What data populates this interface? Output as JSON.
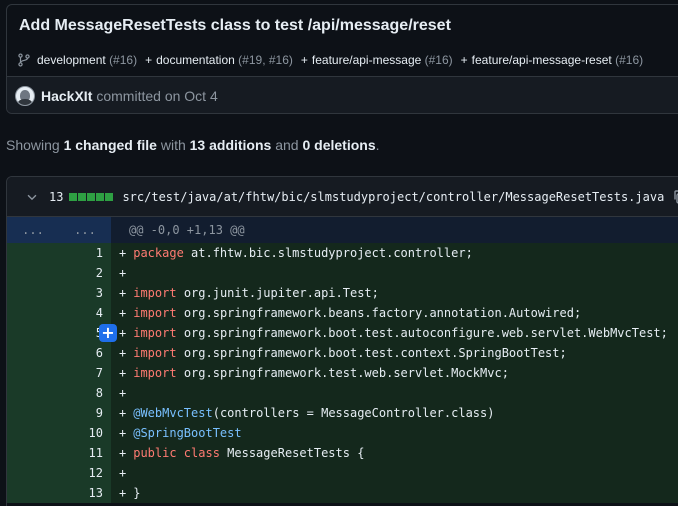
{
  "commit": {
    "title": "Add MessageResetTests class to test /api/message/reset",
    "branches": [
      {
        "name": "development",
        "count": "(#16)"
      },
      {
        "name": "documentation",
        "count": "(#19, #16)"
      },
      {
        "name": "feature/api-message",
        "count": "(#16)"
      },
      {
        "name": "feature/api-message-reset",
        "count": "(#16)"
      }
    ],
    "author": "HackXIt",
    "committed_text": "committed on Oct 4"
  },
  "summary": {
    "showing": "Showing",
    "files_changed": "1 changed file",
    "with": "with",
    "additions": "13 additions",
    "and": "and",
    "deletions": "0 deletions",
    "period": "."
  },
  "file": {
    "additions_count": "13",
    "path": "src/test/java/at/fhtw/bic/slmstudyproject/controller/MessageResetTests.java"
  },
  "hunk": {
    "expand_left": "...",
    "expand_right": "...",
    "header": "@@ -0,0 +1,13 @@"
  },
  "lines": [
    {
      "n": "1",
      "kw": "package",
      "text": " at.fhtw.bic.slmstudyproject.controller;"
    },
    {
      "n": "2",
      "kw": "",
      "text": ""
    },
    {
      "n": "3",
      "kw": "import",
      "text": " org.junit.jupiter.api.Test;"
    },
    {
      "n": "4",
      "kw": "import",
      "text": " org.springframework.beans.factory.annotation.Autowired;"
    },
    {
      "n": "5",
      "kw": "import",
      "text": " org.springframework.boot.test.autoconfigure.web.servlet.WebMvcTest;"
    },
    {
      "n": "6",
      "kw": "import",
      "text": " org.springframework.boot.test.context.SpringBootTest;"
    },
    {
      "n": "7",
      "kw": "import",
      "text": " org.springframework.test.web.servlet.MockMvc;"
    },
    {
      "n": "8",
      "kw": "",
      "text": ""
    },
    {
      "n": "9",
      "ann": "@WebMvcTest",
      "text": "(controllers = MessageController.class)"
    },
    {
      "n": "10",
      "ann": "@SpringBootTest",
      "text": ""
    },
    {
      "n": "11",
      "kw": "public class",
      "text": " MessageResetTests {"
    },
    {
      "n": "12",
      "kw": "",
      "text": ""
    },
    {
      "n": "13",
      "kw": "",
      "text": "}"
    }
  ],
  "add_marker": "+",
  "add_comment_symbol": "+",
  "colors": {
    "background": "#0d1117",
    "addition_bg": "#14281c",
    "addition_num_bg": "#1a3a28",
    "hunk_bg": "#121d2f",
    "keyword": "#ff7b72",
    "annotation": "#79c0ff",
    "diffstat_green": "#2ea043",
    "accent_blue": "#1f6feb"
  },
  "icons": [
    "git-branch-icon",
    "avatar",
    "chevron-down-icon",
    "copy-icon",
    "add-comment-icon"
  ]
}
